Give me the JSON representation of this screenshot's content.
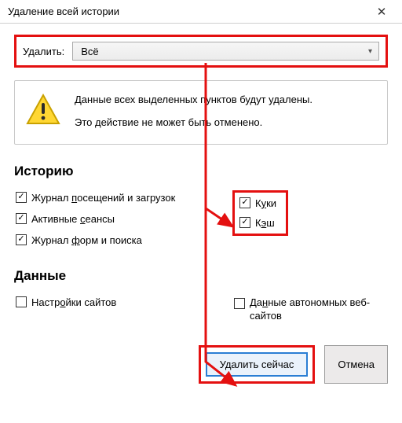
{
  "window": {
    "title": "Удаление всей истории",
    "close_glyph": "✕"
  },
  "timerange": {
    "label": "Удалить:",
    "selected": "Всё"
  },
  "warning": {
    "line1": "Данные всех выделенных пунктов будут удалены.",
    "line2": "Это действие не может быть отменено."
  },
  "sections": {
    "history": "Историю",
    "data": "Данные"
  },
  "checkboxes": {
    "visits": {
      "label_pre": "Журнал ",
      "label_u": "п",
      "label_post": "осещений и загрузок",
      "checked": true
    },
    "sessions": {
      "label_pre": "Активные ",
      "label_u": "с",
      "label_post": "еансы",
      "checked": true
    },
    "forms": {
      "label_pre": "Журнал ",
      "label_u": "ф",
      "label_post": "орм и поиска",
      "checked": true
    },
    "cookies": {
      "label_pre": "К",
      "label_u": "у",
      "label_post": "ки",
      "checked": true
    },
    "cache": {
      "label_pre": "К",
      "label_u": "э",
      "label_post": "ш",
      "checked": true
    },
    "site_settings": {
      "label_pre": "Настр",
      "label_u": "о",
      "label_post": "йки сайтов",
      "checked": false
    },
    "offline": {
      "label_pre": "Да",
      "label_u": "н",
      "label_post": "ные автономных веб-сайтов",
      "checked": false
    }
  },
  "buttons": {
    "delete_now": "Удалить сейчас",
    "cancel": "Отмена"
  },
  "annotation": {
    "color": "#e41010"
  }
}
